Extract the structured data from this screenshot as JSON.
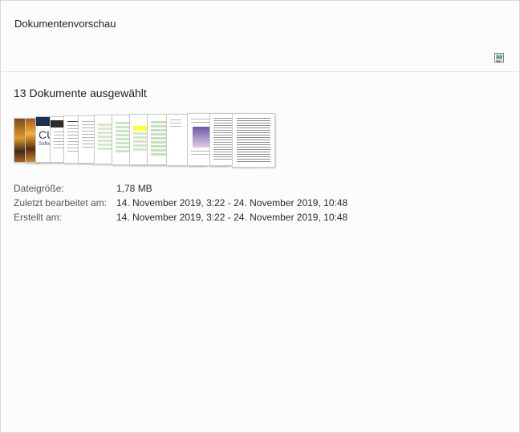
{
  "header": {
    "title": "Dokumentenvorschau",
    "view_icon": "image-view-icon"
  },
  "selection": {
    "count_text": "13 Dokumente ausgewählt"
  },
  "thumbnails": [
    "photo-fire",
    "photo-brochure-cu",
    "dark-cover",
    "text-page",
    "list-page",
    "table-page",
    "green-table",
    "yellow-table",
    "green-table",
    "sparse-page",
    "image-page",
    "dense-text",
    "dense-text"
  ],
  "thumb_text": {
    "cover": "CU",
    "cover_sub": "Softw"
  },
  "properties": [
    {
      "label": "Dateigröße:",
      "value": "1,78 MB"
    },
    {
      "label": "Zuletzt bearbeitet am:",
      "value": "14. November 2019, 3:22 - 24. November 2019, 10:48"
    },
    {
      "label": "Erstellt am:",
      "value": "14. November 2019, 3:22 - 24. November 2019, 10:48"
    }
  ]
}
